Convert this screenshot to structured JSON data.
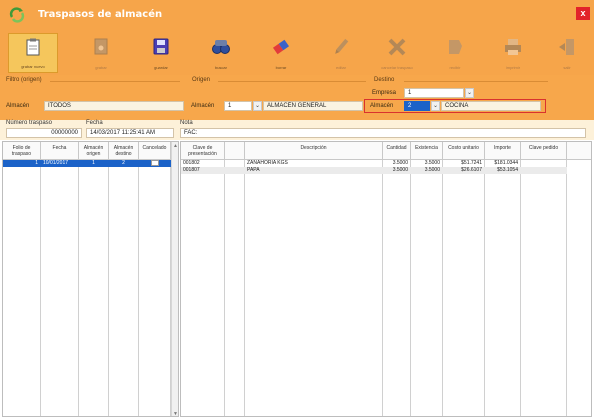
{
  "window": {
    "title": "Traspasos de almacén",
    "close_label": "x"
  },
  "toolbar": {
    "buttons": [
      {
        "name": "nuevo-button",
        "icon": "new-document-icon",
        "label": "grabar nuevo"
      },
      {
        "name": "grabar-button",
        "icon": "save-icon",
        "label": "grabar"
      },
      {
        "name": "guardar-button",
        "icon": "save-icon",
        "label": "guardar"
      },
      {
        "name": "buscar-button",
        "icon": "search-binoculars-icon",
        "label": "buscar"
      },
      {
        "name": "borrar-button",
        "icon": "eraser-icon",
        "label": "borrar"
      },
      {
        "name": "editar-button",
        "icon": "pencil-icon",
        "label": "editar"
      },
      {
        "name": "cancelar-button",
        "icon": "cancel-x-icon",
        "label": "cancelar traspaso"
      },
      {
        "name": "recibir-button",
        "icon": "receive-icon",
        "label": "recibir"
      },
      {
        "name": "imprimir-button",
        "icon": "printer-icon",
        "label": "imprimir"
      },
      {
        "name": "salir-button",
        "icon": "exit-door-icon",
        "label": "salir"
      }
    ]
  },
  "filtro": {
    "group_label": "Filtro (origen)",
    "almacen_label": "Almacén",
    "almacen_value": "ITODOS",
    "origen_group_label": "Origen",
    "origen_almacen_label": "Almacén",
    "origen_almacen_num": "1",
    "origen_almacen_name": "ALMACÉN GENERAL",
    "destino_group_label": "Destino",
    "empresa_label": "Empresa",
    "empresa_value": "1",
    "destino_almacen_label": "Almacén",
    "destino_almacen_num": "2",
    "destino_almacen_name": "COCINA"
  },
  "info": {
    "numero_label": "Número traspaso",
    "numero_value": "00000000",
    "fecha_label": "Fecha",
    "fecha_value": "14/03/2017 11:25:41 AM",
    "nota_label": "Nota",
    "nota_value": "FAC:"
  },
  "left_grid": {
    "columns": [
      "Folio de traspaso",
      "Fecha",
      "Almacén origen",
      "Almacén destino",
      "Cancelado"
    ],
    "rows": [
      {
        "folio": "1",
        "fecha": "10/01/2017",
        "origen": "1",
        "destino": "2",
        "cancelado": false
      }
    ]
  },
  "right_grid": {
    "columns": [
      "Clave de presentación",
      "Descripción",
      "Cantidad",
      "Existencia",
      "Costo unitario",
      "Importe",
      "Clave pedido"
    ],
    "rows": [
      {
        "clave": "001802",
        "descripcion": "ZANAHORIA KGS",
        "cantidad": "3.5000",
        "existencia": "3.5000",
        "costo": "$51.7241",
        "importe": "$181.0344",
        "pedido": ""
      },
      {
        "clave": "001807",
        "descripcion": "PAPA",
        "cantidad": "3.5000",
        "existencia": "3.5000",
        "costo": "$26.6107",
        "importe": "$53.1054",
        "pedido": ""
      }
    ]
  },
  "colors": {
    "accent": "#f6a54a",
    "selection": "#1b62c8",
    "highlight": "#d9322e"
  }
}
